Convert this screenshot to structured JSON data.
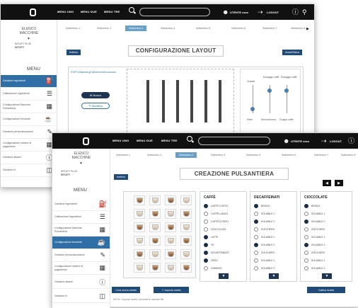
{
  "topbar": {
    "menu1": "MENU UNO",
    "menu2": "MENU DUE",
    "menu3": "MENU TRE",
    "user": "UTENTE xxxx",
    "logout": "LOGOUT"
  },
  "subtabs": [
    "Sottomenu 1",
    "Sottomenu 2",
    "Sottomenu 3",
    "Sottomenu 4",
    "Sottomenu 5",
    "Sottomenu 6",
    "Sottomenu 7",
    "Sottomenu 8"
  ],
  "sidebar": {
    "elenco": "ELENCO MACCHINE",
    "machine_name": "INTUITY PLUS",
    "machine_id": "INTUITY",
    "menu_title": "MENU",
    "items": [
      {
        "label": "Gestione ingredienti"
      },
      {
        "label": "Calibrazione ingredienti"
      },
      {
        "label": "Configurazione Machine Pulsantiera"
      },
      {
        "label": "Configurazione bevande"
      },
      {
        "label": "Gestione personalizzazioni"
      },
      {
        "label": "Configurazione sistemi di pagamento"
      },
      {
        "label": "Gestione allarmi"
      },
      {
        "label": "Gestione lil"
      }
    ]
  },
  "back_window": {
    "title": "CONFIGURAZIONE LAYOUT",
    "indietro": "Indietro",
    "avanti": "Avanti/Salva",
    "hint": "STEP 1/trascina gli elementi nella colonna",
    "nuovo": "Nuovo",
    "modifica": "Modifica",
    "labels": [
      "Grande",
      "Dosaggio caffè",
      "Dosaggio caffè",
      "Mixer",
      "Servocolonna",
      "Gruppo caffè"
    ]
  },
  "front_window": {
    "title": "CREAZIONE PULSANTIERA",
    "indietro": "Indietro",
    "crea_label": "Crea nuova ricetta",
    "importa_label": "Importa ricetta",
    "calibra_label": "Calibra ricetta",
    "nota": "NOTA: \"Importa ricetta\" permette di caricare file",
    "columns": [
      {
        "title": "CAFFÈ",
        "options": [
          {
            "label": "CAFFÈ CORTO",
            "on": true
          },
          {
            "label": "CAFFÈ LUNGO",
            "on": false
          },
          {
            "label": "CAFFÈ D'ORZO",
            "on": false
          },
          {
            "label": "CIOCCOLATA",
            "on": false
          },
          {
            "label": "LATTE",
            "on": true
          },
          {
            "label": "TÈ",
            "on": true
          },
          {
            "label": "DECAFFEINATO",
            "on": true
          },
          {
            "label": "ORZO",
            "on": true
          },
          {
            "label": "GINSENG",
            "on": false
          }
        ]
      },
      {
        "title": "DECAFFEINATI",
        "options": [
          {
            "label": "BRODO",
            "on": true
          },
          {
            "label": "SOLUBILE 1",
            "on": false
          },
          {
            "label": "SOLUBILE 2",
            "on": true
          },
          {
            "label": "ZUCCHERO",
            "on": false
          },
          {
            "label": "SOLUBILE 1",
            "on": false
          },
          {
            "label": "SOLUBILE 2",
            "on": true
          },
          {
            "label": "ZUCCHERO",
            "on": false
          },
          {
            "label": "SOLUBILE 1",
            "on": false
          },
          {
            "label": "SOLUBILE 2",
            "on": false
          }
        ]
      },
      {
        "title": "CIOCCOLATE",
        "options": [
          {
            "label": "BRODO",
            "on": true
          },
          {
            "label": "SOLUBILE 1",
            "on": false
          },
          {
            "label": "SOLUBILE 2",
            "on": true
          },
          {
            "label": "ZUCCHERO",
            "on": false
          },
          {
            "label": "SOLUBILE 1",
            "on": false
          },
          {
            "label": "SOLUBILE 2",
            "on": true
          },
          {
            "label": "ZUCCHERO",
            "on": false
          },
          {
            "label": "SOLUBILE 1",
            "on": false
          },
          {
            "label": "SOLUBILE 2",
            "on": false
          }
        ]
      }
    ]
  },
  "colors": {
    "accent": "#2f6fa6",
    "dark": "#111111",
    "button": "#204a78"
  }
}
